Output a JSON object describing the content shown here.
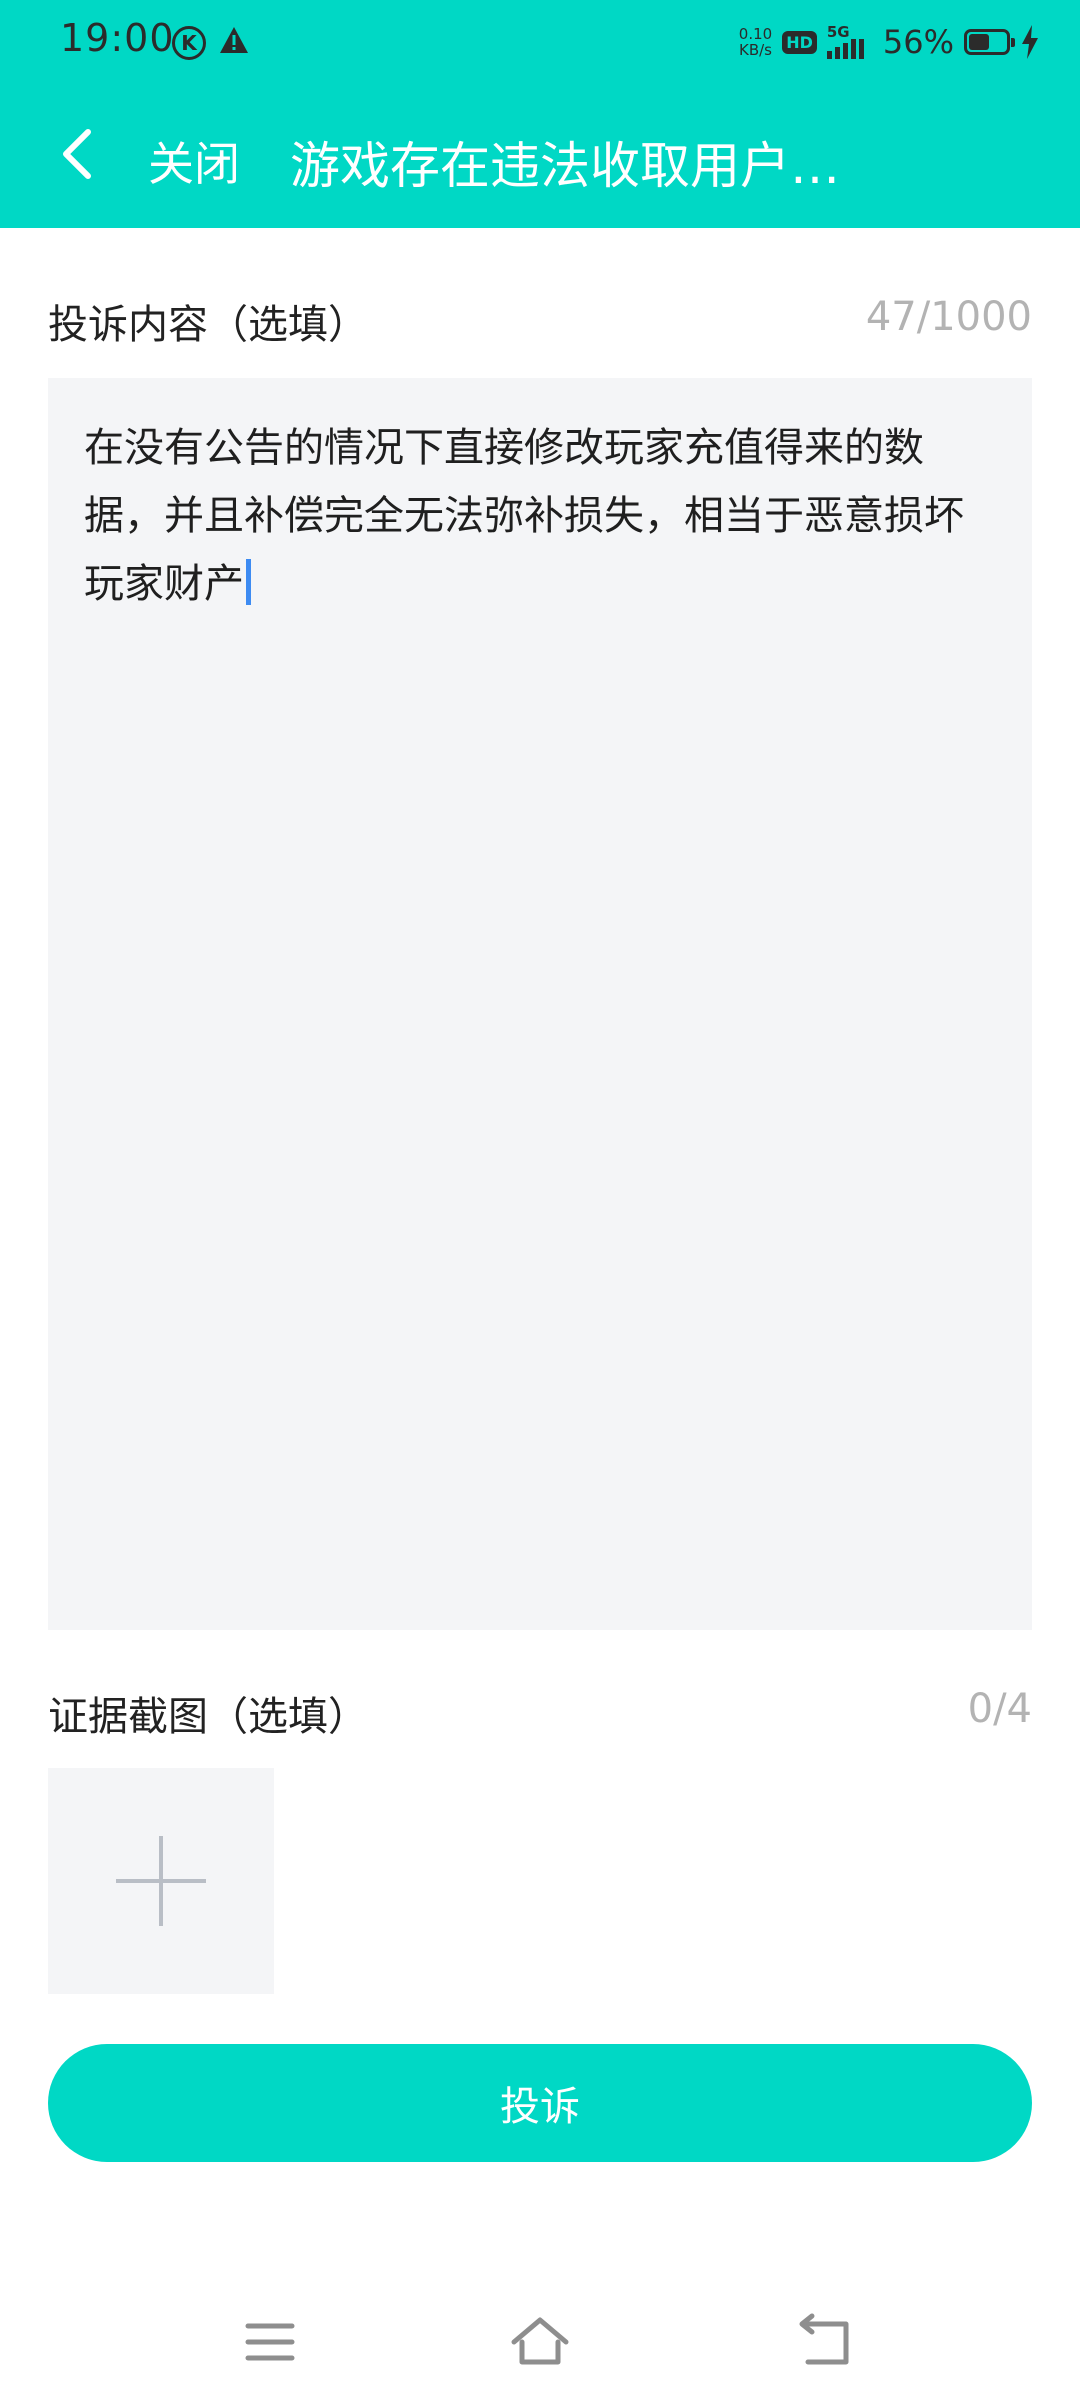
{
  "status_bar": {
    "time": "19:00",
    "k_icon_label": "K",
    "net_speed_value": "0.10",
    "net_speed_unit": "KB/s",
    "hd_label": "HD",
    "network_label": "5G",
    "battery_percent_text": "56%",
    "battery_level": 0.56
  },
  "nav": {
    "close_label": "关闭",
    "title": "游戏存在违法收取用户…"
  },
  "complaint": {
    "label": "投诉内容（选填）",
    "count": "47/1000",
    "text": "在没有公告的情况下直接修改玩家充值得来的数据，并且补偿完全无法弥补损失，相当于恶意损坏玩家财产"
  },
  "evidence": {
    "label": "证据截图（选填）",
    "count": "0/4"
  },
  "submit": {
    "label": "投诉"
  },
  "colors": {
    "accent": "#00D8C5",
    "input_background": "#F4F5F7",
    "caret": "#3d8bf2"
  },
  "icons": {
    "back": "chevron-left-icon",
    "add": "plus-icon",
    "menu": "menu-icon",
    "home": "home-icon",
    "return": "back-arrow-icon"
  }
}
